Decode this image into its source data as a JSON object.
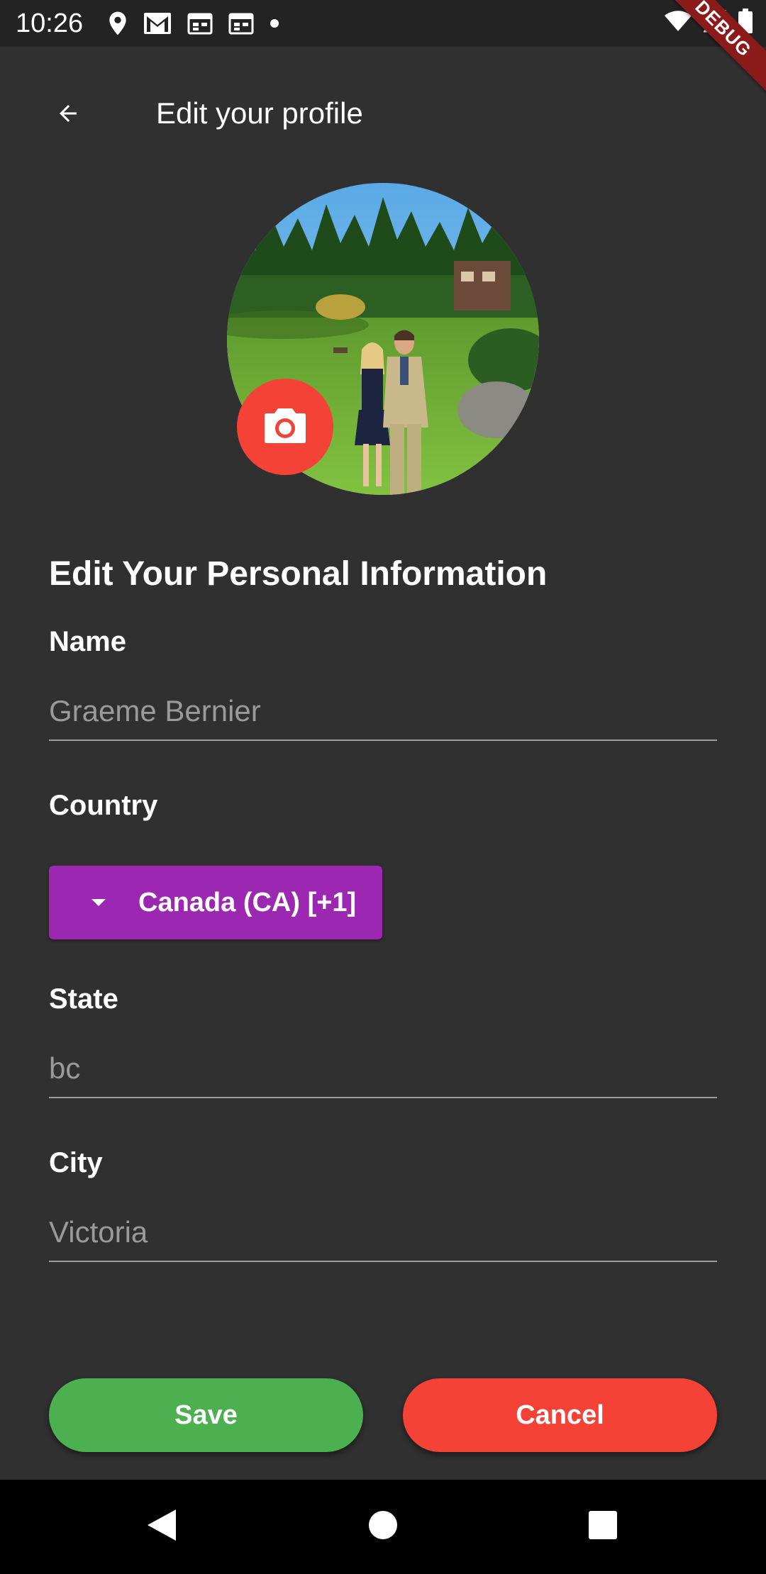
{
  "status_bar": {
    "time": "10:26",
    "debug_label": "DEBUG"
  },
  "app_bar": {
    "title": "Edit your profile"
  },
  "form": {
    "section_title": "Edit Your Personal Information",
    "name": {
      "label": "Name",
      "value": "Graeme Bernier"
    },
    "country": {
      "label": "Country",
      "selected": "Canada (CA) [+1]"
    },
    "state": {
      "label": "State",
      "value": "bc"
    },
    "city": {
      "label": "City",
      "value": "Victoria"
    }
  },
  "actions": {
    "save_label": "Save",
    "cancel_label": "Cancel"
  },
  "colors": {
    "background": "#303030",
    "status_bar": "#232323",
    "accent_purple": "#9c27b0",
    "save_green": "#4caf50",
    "cancel_red": "#f44336",
    "camera_red": "#f44336"
  },
  "icons": {
    "back": "arrow-left-icon",
    "camera": "camera-icon",
    "dropdown": "triangle-down-icon",
    "nav_back": "nav-back-icon",
    "nav_home": "nav-home-icon",
    "nav_recents": "nav-recents-icon"
  }
}
